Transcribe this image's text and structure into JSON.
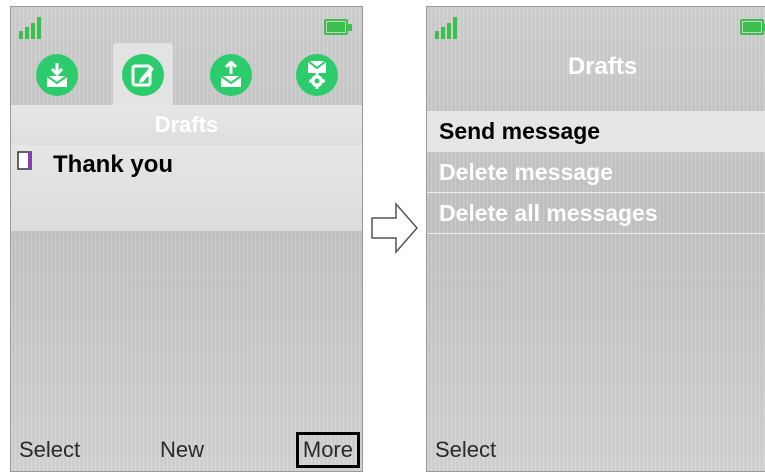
{
  "left_screen": {
    "tabs": [
      {
        "icon": "inbox-download-icon"
      },
      {
        "icon": "drafts-edit-icon",
        "selected": true
      },
      {
        "icon": "outbox-upload-icon"
      },
      {
        "icon": "message-settings-icon"
      }
    ],
    "header": "Drafts",
    "messages": [
      {
        "icon": "draft-document-icon",
        "text": "Thank you"
      }
    ],
    "softkeys": {
      "left": "Select",
      "middle": "New",
      "right": "More"
    }
  },
  "arrow": {
    "icon": "right-arrow-icon"
  },
  "right_screen": {
    "title": "Drafts",
    "menu_items": [
      "Send message",
      "Delete message",
      "Delete all messages"
    ],
    "selected_index": 0,
    "softkeys": {
      "left": "Select"
    }
  },
  "colors": {
    "accent_green": "#2ccb6c",
    "status_green": "#3bbf4f"
  }
}
